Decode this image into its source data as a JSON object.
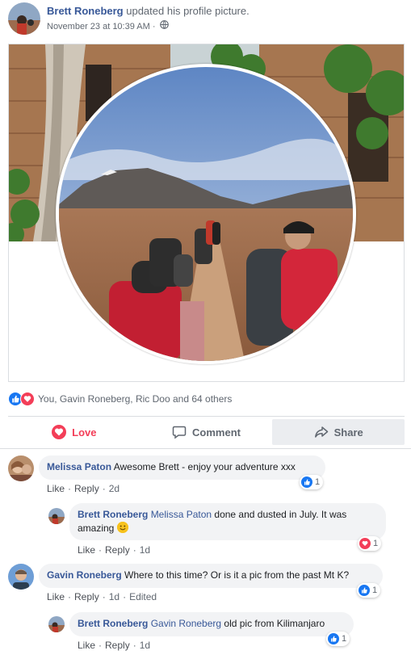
{
  "post": {
    "author": "Brett Roneberg",
    "action_text": " updated his profile picture.",
    "timestamp": "November 23 at 10:39 AM",
    "separator": "·",
    "privacy_icon": "globe-icon"
  },
  "reactions": {
    "icons": [
      "like-reaction-icon",
      "love-reaction-icon"
    ],
    "summary": "You, Gavin Roneberg, Ric Doo and 64 others"
  },
  "actions": {
    "love_label": "Love",
    "comment_label": "Comment",
    "share_label": "Share"
  },
  "comments": [
    {
      "author": "Melissa Paton",
      "text": "Awesome Brett - enjoy your adventure xxx",
      "like_label": "Like",
      "reply_label": "Reply",
      "time": "2d",
      "reaction_icon": "like-reaction-icon",
      "reaction_count": "1",
      "replies": [
        {
          "author": "Brett Roneberg",
          "mention": "Melissa Paton",
          "text": " done and dusted in July. It was amazing ",
          "emoji": "smile-emoji",
          "like_label": "Like",
          "reply_label": "Reply",
          "time": "1d",
          "reaction_icon": "love-reaction-icon",
          "reaction_count": "1"
        }
      ]
    },
    {
      "author": "Gavin Roneberg",
      "text": "Where to this time? Or is it a pic from the past Mt K?",
      "like_label": "Like",
      "reply_label": "Reply",
      "time": "1d",
      "edited_label": "Edited",
      "reaction_icon": "like-reaction-icon",
      "reaction_count": "1",
      "replies": [
        {
          "author": "Brett Roneberg",
          "mention": "Gavin Roneberg",
          "text": " old pic from Kilimanjaro",
          "like_label": "Like",
          "reply_label": "Reply",
          "time": "1d",
          "reaction_icon": "like-reaction-icon",
          "reaction_count": "1"
        }
      ]
    }
  ],
  "colors": {
    "link_blue": "#385898",
    "like_blue": "#1877f2",
    "love_red": "#f33e58",
    "bubble_gray": "#f2f3f5",
    "meta_gray": "#606770"
  }
}
